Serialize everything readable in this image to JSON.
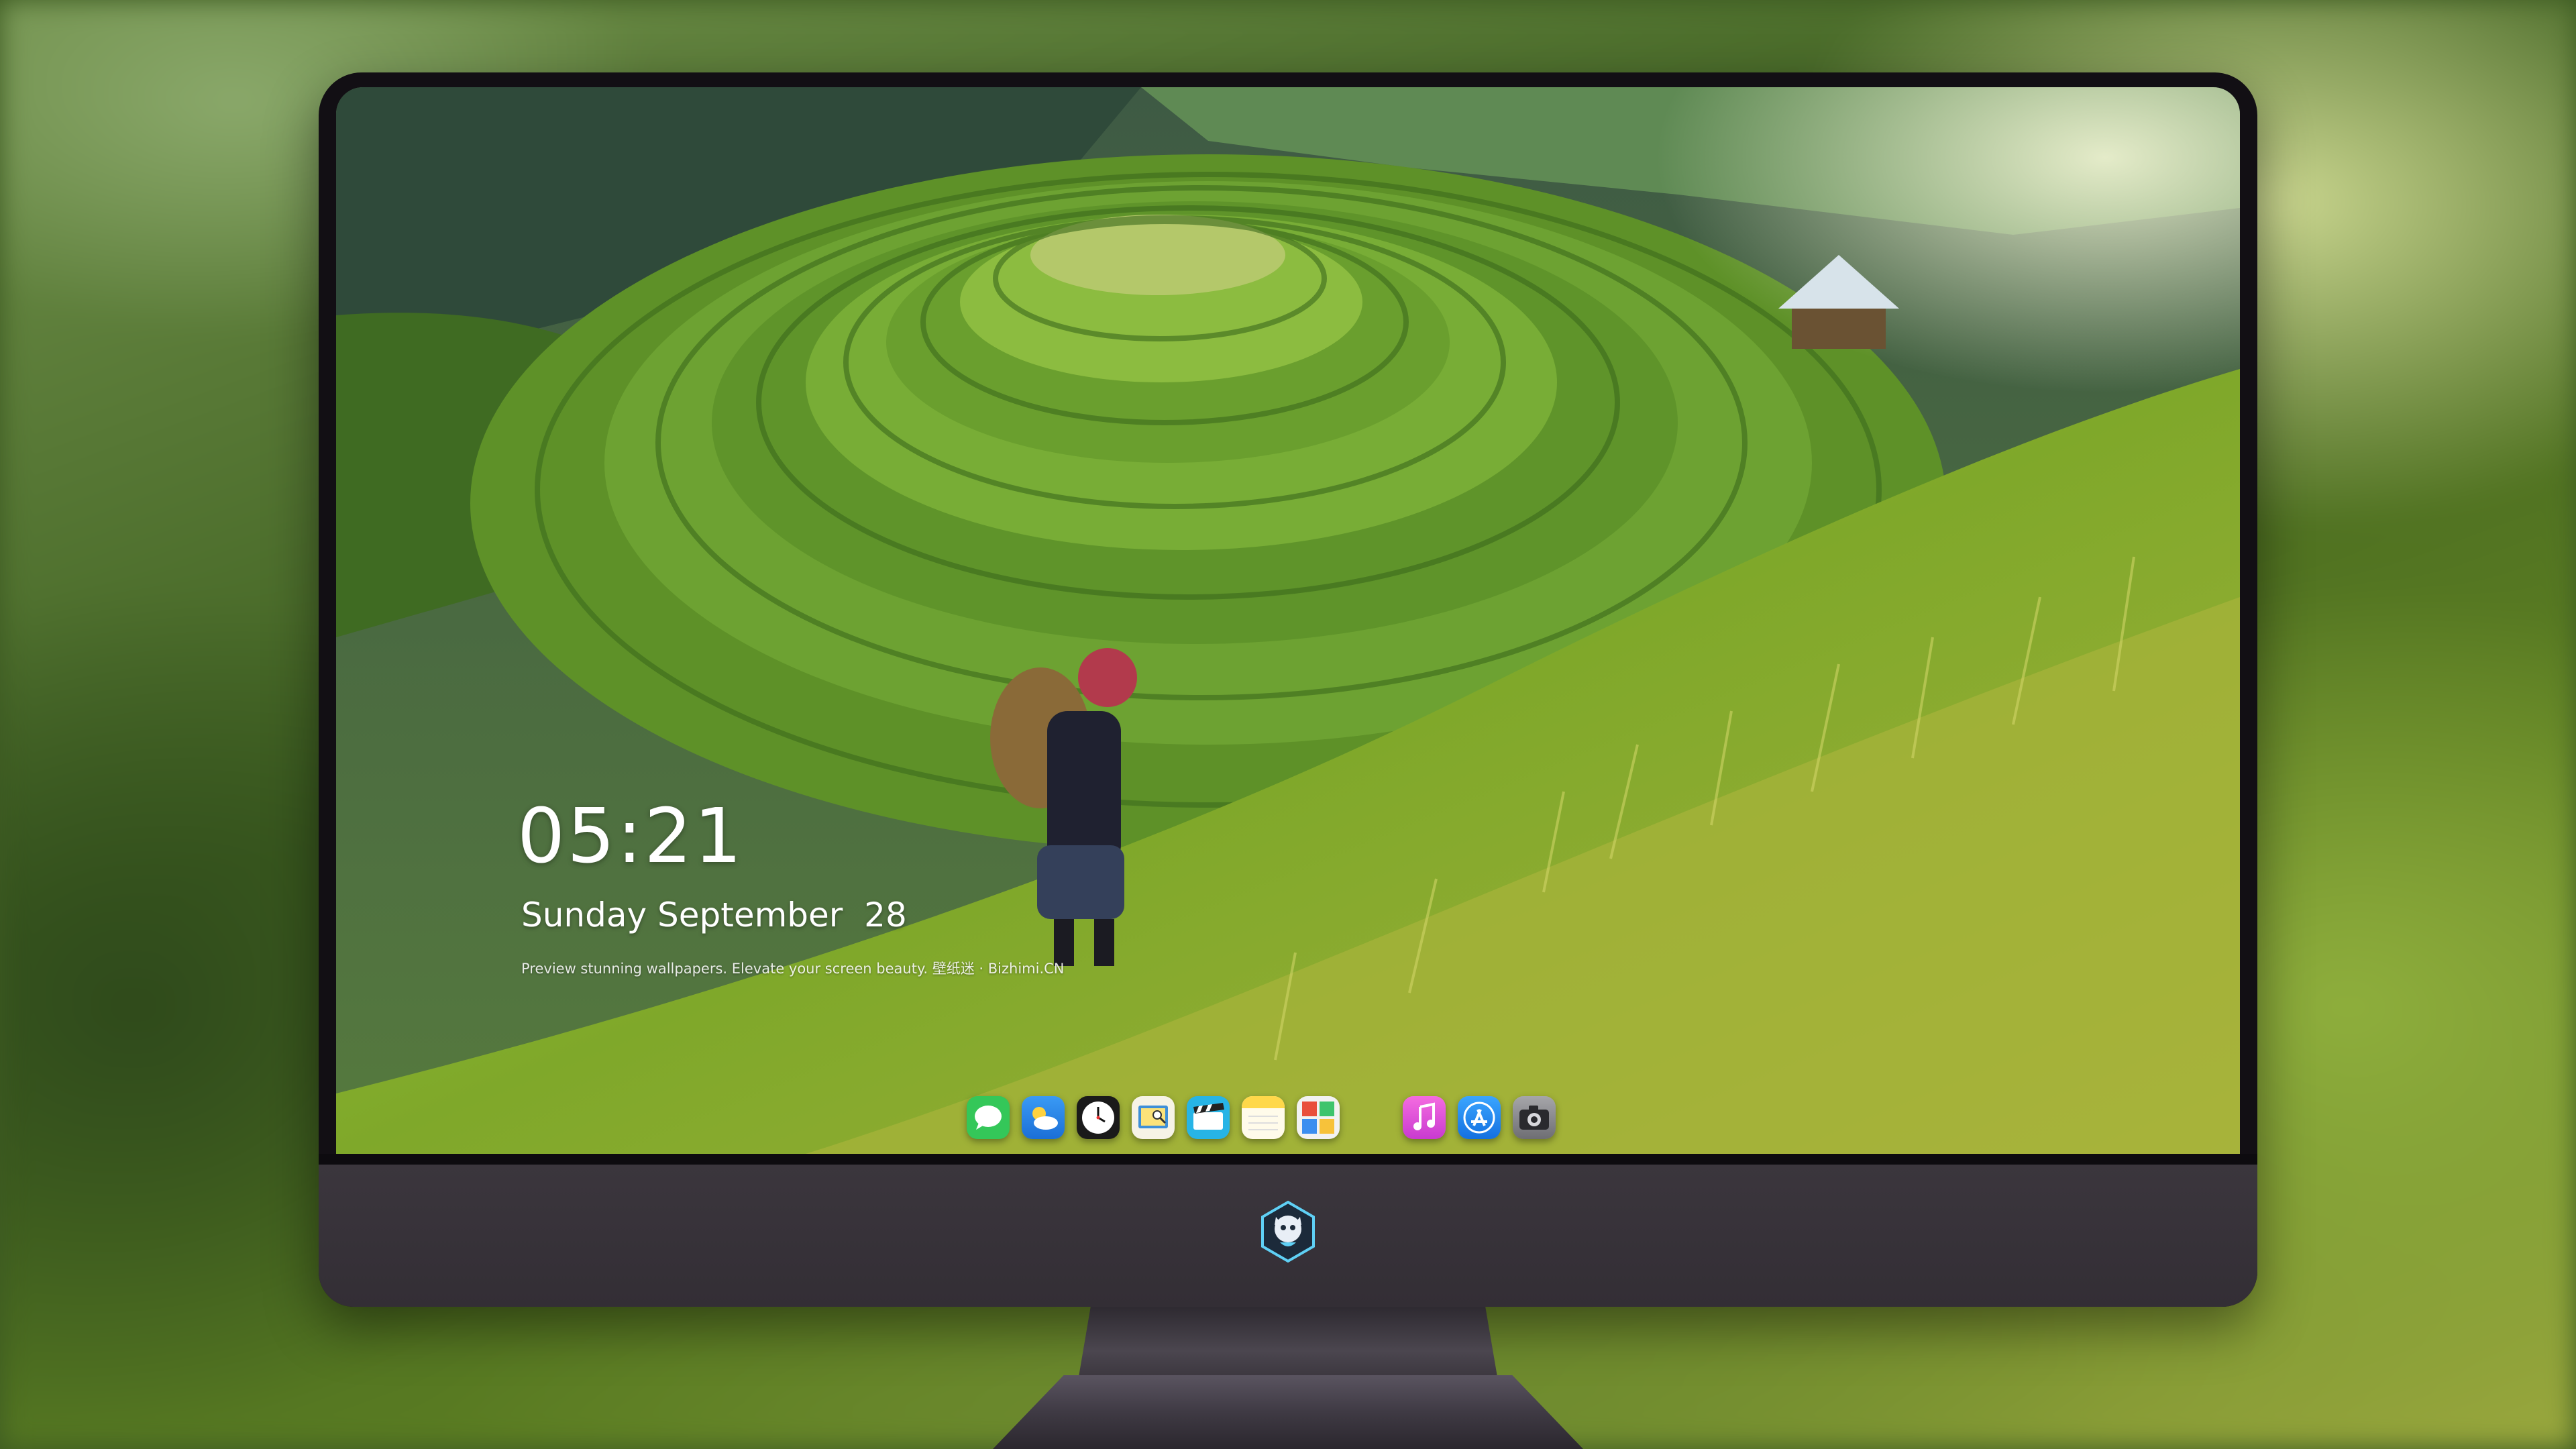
{
  "lock_screen": {
    "time": "05:21",
    "date": "Sunday September  28",
    "tagline": "Preview stunning wallpapers. Elevate your screen beauty. 壁纸迷 · Bizhimi.CN"
  },
  "dock": {
    "apps": [
      {
        "icon": "messages-icon",
        "color": "#34c759"
      },
      {
        "icon": "weather-icon",
        "color": "#2f8cf0"
      },
      {
        "icon": "clock-icon",
        "color": "#1a1a1a"
      },
      {
        "icon": "preview-icon",
        "color": "#f2c94c"
      },
      {
        "icon": "clips-icon",
        "color": "#27b4e6"
      },
      {
        "icon": "notes-icon",
        "color": "#ffd84a"
      },
      {
        "icon": "photo-booth-icon",
        "color": "#e94e3c"
      },
      {
        "icon": "music-icon",
        "color": "#e94bd2"
      },
      {
        "icon": "app-store-icon",
        "color": "#1e8ef5"
      },
      {
        "icon": "camera-icon",
        "color": "#8e8e93"
      }
    ]
  },
  "colors": {
    "bezel": "#120f14",
    "chin": "#3b363d"
  }
}
